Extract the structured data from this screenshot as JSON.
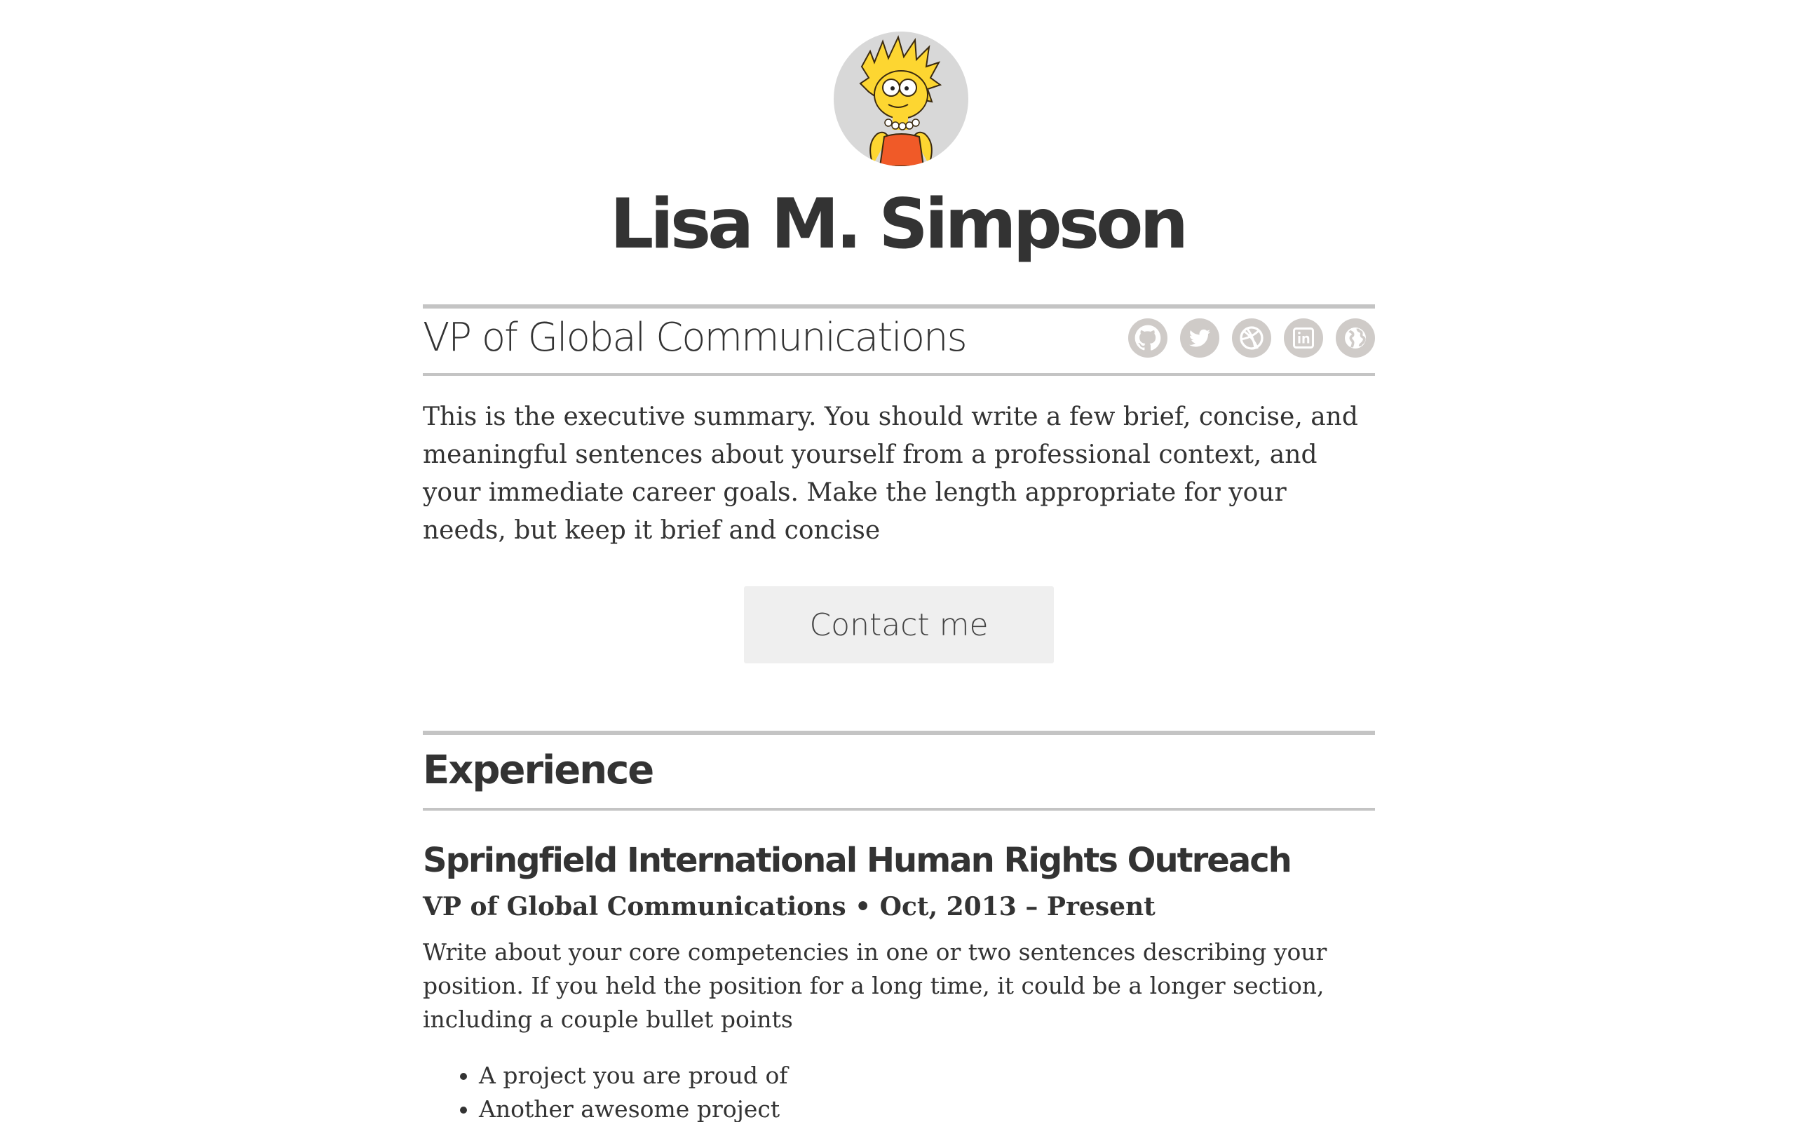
{
  "profile": {
    "name": "Lisa M. Simpson",
    "title": "VP of Global Communications",
    "summary": "This is the executive summary. You should write a few brief, concise, and meaningful sentences about yourself from a professional context, and your immediate career goals. Make the length appropriate for your needs, but keep it brief and concise",
    "contact_label": "Contact me"
  },
  "social": [
    {
      "icon": "github-icon"
    },
    {
      "icon": "twitter-icon"
    },
    {
      "icon": "dribbble-icon"
    },
    {
      "icon": "linkedin-icon"
    },
    {
      "icon": "globe-icon"
    }
  ],
  "experience": {
    "heading": "Experience",
    "jobs": [
      {
        "company": "Springfield International Human Rights Outreach",
        "position_line": "VP of Global Communications • Oct, 2013 – Present",
        "description": "Write about your core competencies in one or two sentences describing your position. If you held the position for a long time, it could be a longer section, including a couple bullet points",
        "bullets": [
          "A project you are proud of",
          "Another awesome project"
        ]
      }
    ]
  },
  "colors": {
    "text": "#333333",
    "rule": "#c4c4c4",
    "icon_bg": "#cfcbc8",
    "button_bg": "#efefef",
    "avatar_bg": "#d8d8d8",
    "avatar_dress": "#f05a28",
    "avatar_skin": "#fdd631"
  }
}
